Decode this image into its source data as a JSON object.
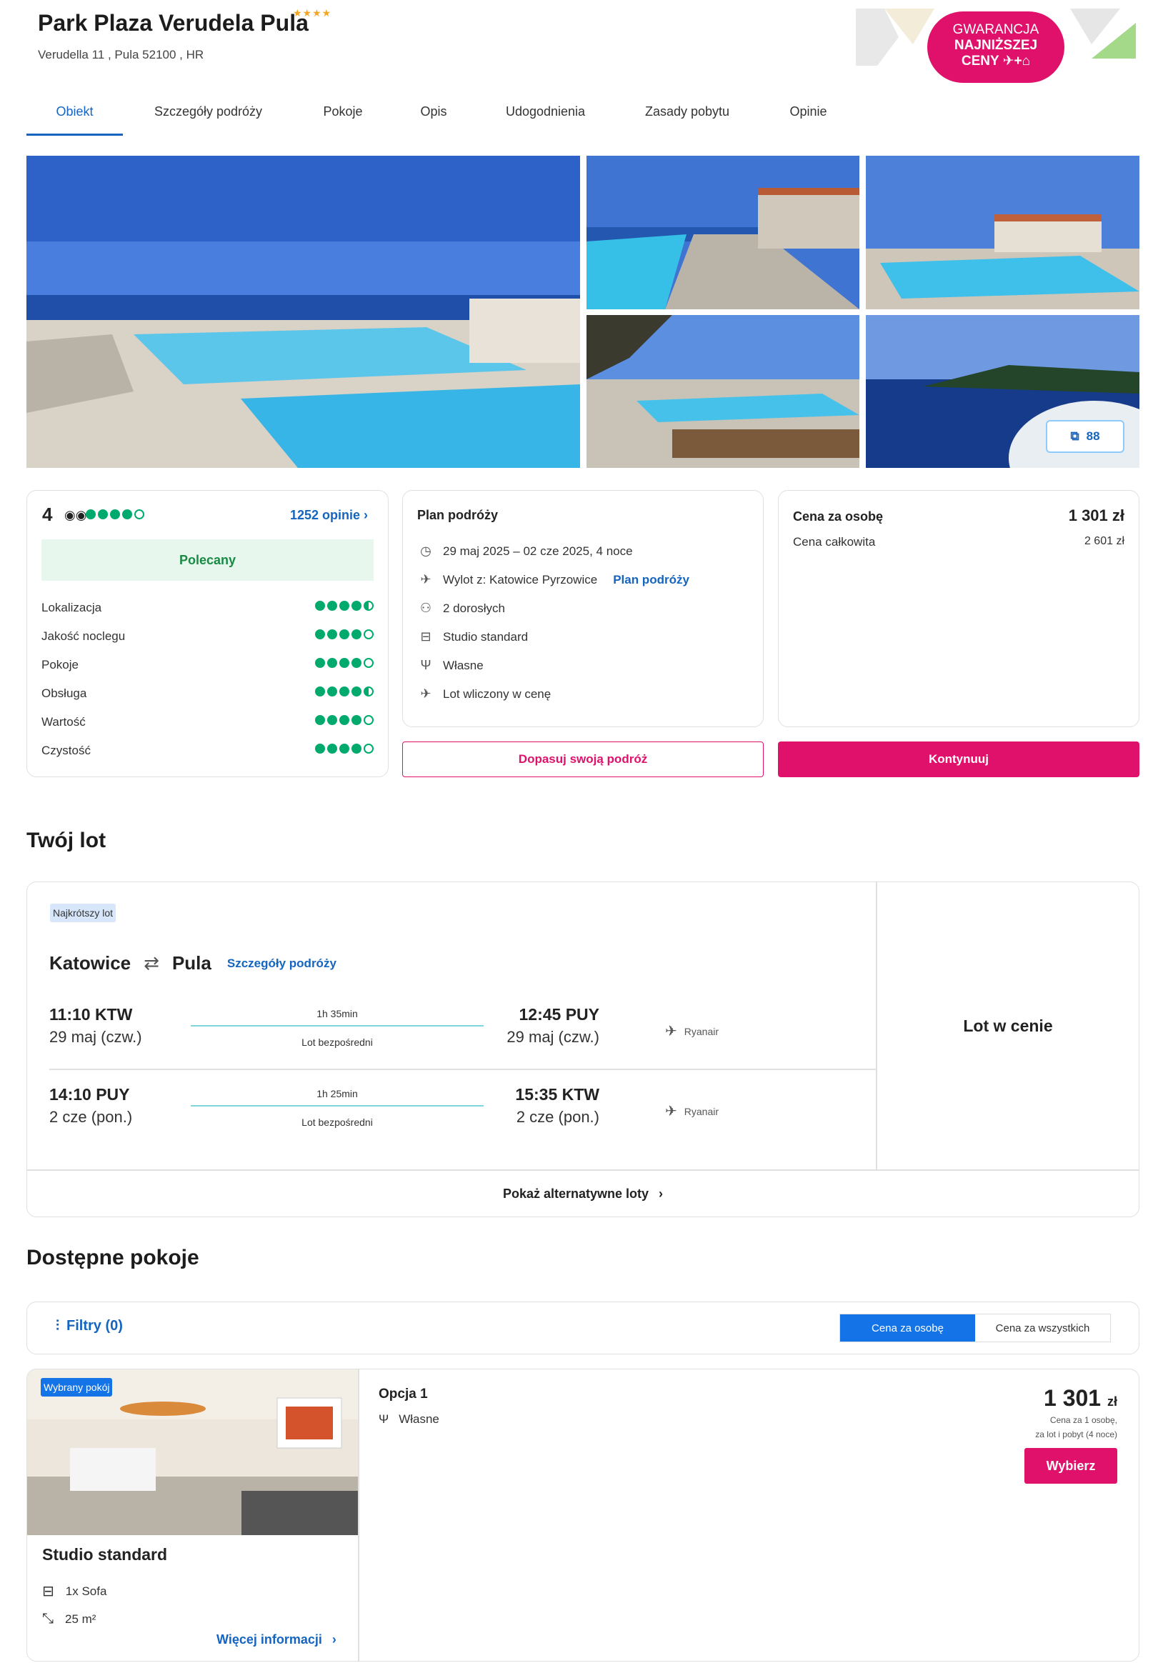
{
  "hotel": {
    "name": "Park Plaza Verudela Pula",
    "stars": "★★★★",
    "address": "Verudella 11 , Pula 52100 , HR"
  },
  "guarantee": {
    "line1": "GWARANCJA",
    "line2": "NAJNIŻSZEJ",
    "line3": "CENY ✈+⌂"
  },
  "tabs": [
    "Obiekt",
    "Szczegóły podróży",
    "Pokoje",
    "Opis",
    "Udogodnienia",
    "Zasady pobytu",
    "Opinie"
  ],
  "gallery": {
    "photo_count": "88"
  },
  "rating": {
    "score": "4",
    "reviews_link": "1252 opinie",
    "recommended": "Polecany",
    "overall_dots": 4,
    "criteria": [
      {
        "label": "Lokalizacja",
        "dots": 4.5
      },
      {
        "label": "Jakość noclegu",
        "dots": 4
      },
      {
        "label": "Pokoje",
        "dots": 4
      },
      {
        "label": "Obsługa",
        "dots": 4.5
      },
      {
        "label": "Wartość",
        "dots": 4
      },
      {
        "label": "Czystość",
        "dots": 4
      }
    ]
  },
  "plan": {
    "title": "Plan podróży",
    "dates": "29 maj 2025 – 02 cze 2025, 4 noce",
    "departure": "Wylot z: Katowice Pyrzowice",
    "departure_link": "Plan podróży",
    "guests": "2 dorosłych",
    "room": "Studio standard",
    "meal": "Własne",
    "flight_included": "Lot wliczony w cenę"
  },
  "price": {
    "per_person_label": "Cena za osobę",
    "per_person_value": "1 301 zł",
    "total_label": "Cena całkowita",
    "total_value": "2 601 zł"
  },
  "buttons": {
    "customize": "Dopasuj swoją podróż",
    "continue": "Kontynuuj"
  },
  "flight": {
    "section_title": "Twój lot",
    "badge": "Najkrótszy lot",
    "from": "Katowice",
    "to": "Pula",
    "details_link": "Szczegóły podróży",
    "legs": [
      {
        "dep_time": "11:10 KTW",
        "dep_date": "29 maj (czw.)",
        "duration": "1h 35min",
        "type": "Lot bezpośredni",
        "arr_time": "12:45 PUY",
        "arr_date": "29 maj (czw.)",
        "airline": "Ryanair"
      },
      {
        "dep_time": "14:10 PUY",
        "dep_date": "2 cze (pon.)",
        "duration": "1h 25min",
        "type": "Lot bezpośredni",
        "arr_time": "15:35 KTW",
        "arr_date": "2 cze (pon.)",
        "airline": "Ryanair"
      }
    ],
    "price_note": "Lot w cenie",
    "alt_flights": "Pokaż alternatywne loty"
  },
  "rooms": {
    "section_title": "Dostępne pokoje",
    "filters": "Filtry (0)",
    "toggle": [
      "Cena za osobę",
      "Cena za wszystkich"
    ],
    "card": {
      "badge": "Wybrany pokój",
      "name": "Studio standard",
      "bed": "1x Sofa",
      "area": "25 m²",
      "more": "Więcej informacji",
      "option": "Opcja 1",
      "meal": "Własne",
      "price": "1 301",
      "currency": "zł",
      "note1": "Cena za 1 osobę,",
      "note2": "za lot i pobyt (4 noce)",
      "choose": "Wybierz"
    }
  },
  "colors": {
    "brand_pink": "#e0116b",
    "link_blue": "#1565c0",
    "tripadvisor_green": "#00aa6c"
  }
}
